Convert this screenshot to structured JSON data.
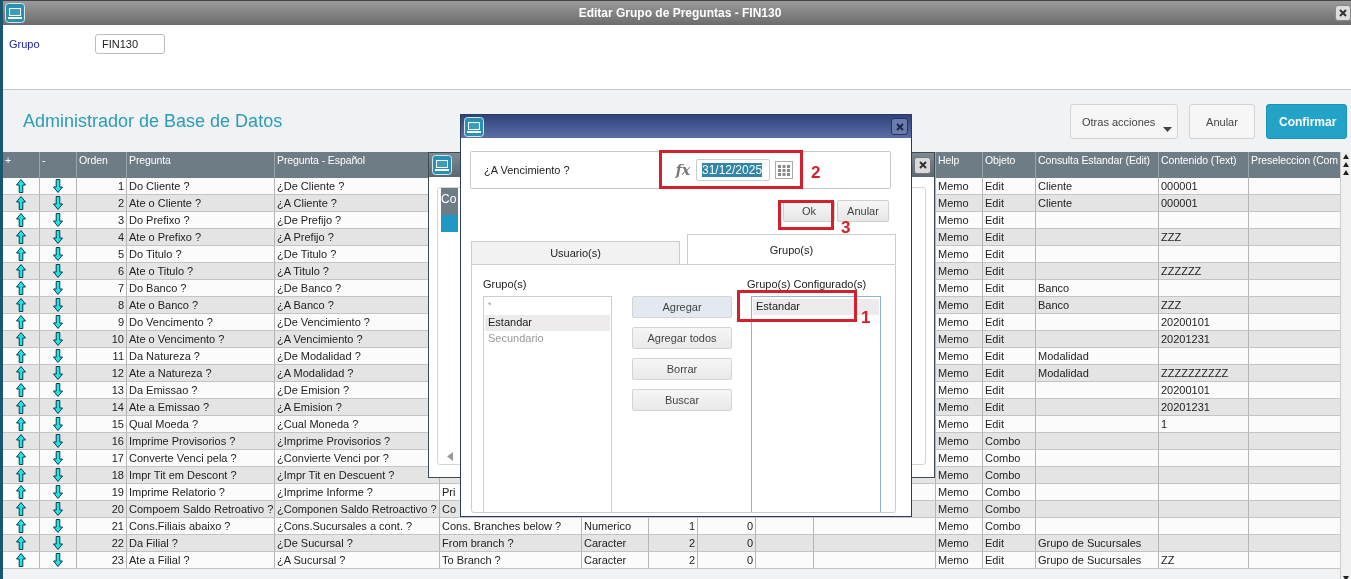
{
  "window": {
    "title": "Editar Grupo de Preguntas - FIN130"
  },
  "form": {
    "label": "Grupo",
    "value": "FIN130"
  },
  "toolbar": {
    "title": "Administrador de Base de Datos",
    "buttons": [
      {
        "label": "Otras acciones",
        "kind": "menu"
      },
      {
        "label": "Anular",
        "kind": "plain"
      },
      {
        "label": "Confirmar",
        "kind": "primary"
      }
    ]
  },
  "table": {
    "columns_left": [
      "+",
      "-",
      "Orden",
      "Pregunta",
      "Pregunta - Español"
    ],
    "columns_right": [
      "Help",
      "Objeto",
      "Consulta Estandar (Edit)",
      "Contenido (Text)",
      "Preseleccion (Com"
    ],
    "rows": [
      {
        "orden": "1",
        "pregunta": "Do Cliente ?",
        "pregunta_es": "¿De Cliente ?",
        "help": "Memo",
        "objeto": "Edit",
        "consulta": "Cliente",
        "contenido": "000001"
      },
      {
        "orden": "2",
        "pregunta": "Ate o Cliente ?",
        "pregunta_es": "¿A Cliente ?",
        "help": "Memo",
        "objeto": "Edit",
        "consulta": "Cliente",
        "contenido": "000001"
      },
      {
        "orden": "3",
        "pregunta": "Do Prefixo ?",
        "pregunta_es": "¿De Prefijo ?",
        "help": "Memo",
        "objeto": "Edit"
      },
      {
        "orden": "4",
        "pregunta": "Ate o Prefixo ?",
        "pregunta_es": "¿A Prefijo ?",
        "help": "Memo",
        "objeto": "Edit",
        "contenido": "ZZZ"
      },
      {
        "orden": "5",
        "pregunta": "Do Titulo ?",
        "pregunta_es": "¿De Titulo ?",
        "help": "Memo",
        "objeto": "Edit"
      },
      {
        "orden": "6",
        "pregunta": "Ate o Titulo ?",
        "pregunta_es": "¿A Titulo ?",
        "help": "Memo",
        "objeto": "Edit",
        "contenido": "ZZZZZZ"
      },
      {
        "orden": "7",
        "pregunta": "Do Banco ?",
        "pregunta_es": "¿De Banco ?",
        "help": "Memo",
        "objeto": "Edit",
        "consulta": "Banco"
      },
      {
        "orden": "8",
        "pregunta": "Ate o Banco ?",
        "pregunta_es": "¿A Banco ?",
        "help": "Memo",
        "objeto": "Edit",
        "consulta": "Banco",
        "contenido": "ZZZ"
      },
      {
        "orden": "9",
        "pregunta": "Do Vencimento ?",
        "pregunta_es": "¿De Vencimiento ?",
        "help": "Memo",
        "objeto": "Edit",
        "contenido": "20200101"
      },
      {
        "orden": "10",
        "pregunta": "Ate o Vencimento ?",
        "pregunta_es": "¿A Vencimiento ?",
        "help": "Memo",
        "objeto": "Edit",
        "contenido": "20201231"
      },
      {
        "orden": "11",
        "pregunta": "Da Natureza ?",
        "pregunta_es": "¿De Modalidad ?",
        "help": "Memo",
        "objeto": "Edit",
        "consulta": "Modalidad"
      },
      {
        "orden": "12",
        "pregunta": "Ate a Natureza ?",
        "pregunta_es": "¿A Modalidad ?",
        "help": "Memo",
        "objeto": "Edit",
        "consulta": "Modalidad",
        "contenido": "ZZZZZZZZZZ"
      },
      {
        "orden": "13",
        "pregunta": "Da Emissao ?",
        "pregunta_es": "¿De Emision ?",
        "help": "Memo",
        "objeto": "Edit",
        "contenido": "20200101"
      },
      {
        "orden": "14",
        "pregunta": "Ate a Emissao ?",
        "pregunta_es": "¿A Emision ?",
        "help": "Memo",
        "objeto": "Edit",
        "contenido": "20201231"
      },
      {
        "orden": "15",
        "pregunta": "Qual Moeda ?",
        "pregunta_es": "¿Cual Moneda ?",
        "help": "Memo",
        "objeto": "Edit",
        "contenido": "1"
      },
      {
        "orden": "16",
        "pregunta": "Imprime Provisorios ?",
        "pregunta_es": "¿Imprime Provisorios ?",
        "help": "Memo",
        "objeto": "Combo"
      },
      {
        "orden": "17",
        "pregunta": "Converte Venci pela ?",
        "pregunta_es": "¿Convierte Venci por ?",
        "help": "Memo",
        "objeto": "Combo"
      },
      {
        "orden": "18",
        "pregunta": "Impr Tit em Descont ?",
        "pregunta_es": "¿Impr Tit en Descuent ?",
        "help": "Memo",
        "objeto": "Combo"
      },
      {
        "orden": "19",
        "pregunta": "Imprime Relatorio ?",
        "pregunta_es": "¿Imprime Informe ?",
        "column_6": "Pri",
        "help": "Memo",
        "objeto": "Combo"
      },
      {
        "orden": "20",
        "pregunta": "Compoem Saldo Retroativo ?",
        "pregunta_es": "¿Componen Saldo Retroactivo ?",
        "column_6": "Co",
        "help": "Memo",
        "objeto": "Combo"
      },
      {
        "orden": "21",
        "pregunta": "Cons.Filiais abaixo ?",
        "pregunta_es": "¿Cons.Sucursales a cont. ?",
        "column_6": "Cons. Branches below ?",
        "column_7": "Numerico",
        "column_8": "1",
        "column_9": "0",
        "help": "Memo",
        "objeto": "Combo"
      },
      {
        "orden": "22",
        "pregunta": "Da Filial ?",
        "pregunta_es": "¿De Sucursal ?",
        "column_6": "From branch ?",
        "column_7": "Caracter",
        "column_8": "2",
        "column_9": "0",
        "help": "Memo",
        "objeto": "Edit",
        "consulta": "Grupo de Sucursales"
      },
      {
        "orden": "23",
        "pregunta": "Ate a Filial ?",
        "pregunta_es": "¿A Sucursal ?",
        "column_6": "To Branch ?",
        "column_7": "Caracter",
        "column_8": "2",
        "column_9": "0",
        "help": "Memo",
        "objeto": "Edit",
        "consulta": "Grupo de Sucursales",
        "contenido": "ZZ"
      }
    ]
  },
  "back_dialog": {
    "column_header": "Co"
  },
  "question_dialog": {
    "question": "¿A Vencimiento ?",
    "formula_label": "fx",
    "date_value": "31/12/2025",
    "date_selected": true,
    "buttons": [
      {
        "label": "Ok"
      },
      {
        "label": "Anular"
      }
    ],
    "tabs": [
      {
        "label": "Usuario(s)",
        "selected": false
      },
      {
        "label": "Grupo(s)",
        "selected": true
      }
    ],
    "available_label": "Grupo(s)",
    "available": [
      {
        "label": "*",
        "selected": false,
        "disabled": true
      },
      {
        "label": "Estandar",
        "selected": true,
        "disabled": false
      },
      {
        "label": "Secundario",
        "selected": false,
        "disabled": true
      }
    ],
    "actions": [
      {
        "label": "Agregar",
        "focused": true
      },
      {
        "label": "Agregar todos",
        "focused": false
      },
      {
        "label": "Borrar",
        "focused": false
      },
      {
        "label": "Buscar",
        "focused": false
      }
    ],
    "configured_label": "Grupo(s) Configurado(s)",
    "configured": [
      {
        "label": "Estandar",
        "selected": true
      }
    ],
    "annotations": [
      {
        "label": "2"
      },
      {
        "label": "3"
      },
      {
        "label": "1"
      }
    ]
  }
}
